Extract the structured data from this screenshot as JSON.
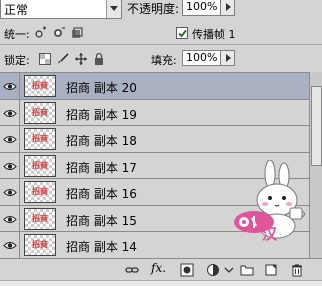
{
  "header": {
    "blend_mode": "正常",
    "opacity_label": "不透明度:",
    "opacity_value": "100%"
  },
  "unify": {
    "label": "统一:",
    "propagate_label": "传播帧 1",
    "propagate_checked": true
  },
  "lock": {
    "label": "锁定:",
    "fill_label": "填充:",
    "fill_value": "100%"
  },
  "layers": [
    {
      "name": "招商 副本 20",
      "selected": true
    },
    {
      "name": "招商 副本 19",
      "selected": false
    },
    {
      "name": "招商 副本 18",
      "selected": false
    },
    {
      "name": "招商 副本 17",
      "selected": false
    },
    {
      "name": "招商 副本 16",
      "selected": false
    },
    {
      "name": "招商 副本 15",
      "selected": false
    },
    {
      "name": "招商 副本 14",
      "selected": false
    }
  ],
  "thumb_text": "招商",
  "bottom": {
    "fx_label": "fx."
  },
  "sticker": {
    "text": "汉"
  },
  "colors": {
    "panel_bg": "#d4d4d4",
    "selected_row": "#a9b0c2",
    "sticker_pink": "#e0559a"
  }
}
